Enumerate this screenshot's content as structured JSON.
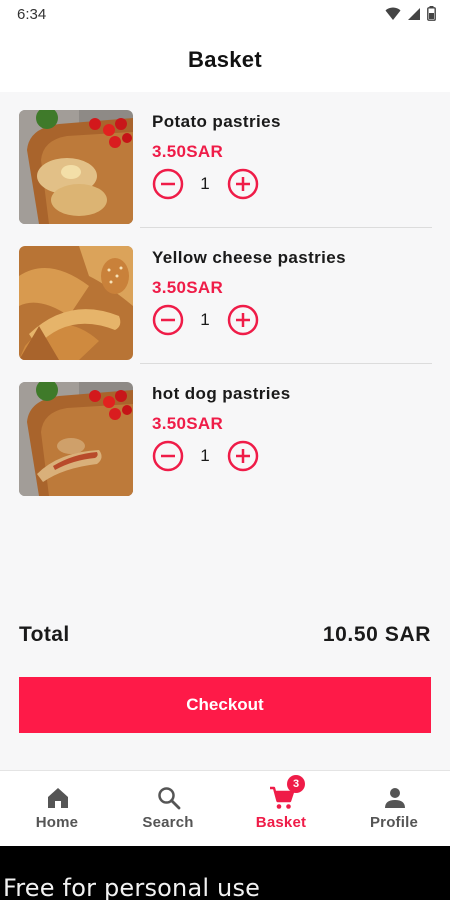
{
  "status_bar": {
    "time": "6:34"
  },
  "header": {
    "title": "Basket"
  },
  "items": [
    {
      "name": "Potato pastries",
      "price": "3.50SAR",
      "quantity": "1"
    },
    {
      "name": "Yellow cheese pastries",
      "price": "3.50SAR",
      "quantity": "1"
    },
    {
      "name": "hot dog pastries",
      "price": "3.50SAR",
      "quantity": "1"
    }
  ],
  "summary": {
    "total_label": "Total",
    "total_value": "10.50 SAR"
  },
  "checkout": {
    "label": "Checkout"
  },
  "nav": {
    "items": [
      {
        "label": "Home",
        "icon": "home-icon"
      },
      {
        "label": "Search",
        "icon": "search-icon"
      },
      {
        "label": "Basket",
        "icon": "cart-icon",
        "badge": "3"
      },
      {
        "label": "Profile",
        "icon": "person-icon"
      }
    ]
  },
  "watermark": {
    "text": "Free for personal use"
  },
  "colors": {
    "accent": "#ef1c48",
    "button": "#fe1a48",
    "background": "#f7f7f8"
  }
}
